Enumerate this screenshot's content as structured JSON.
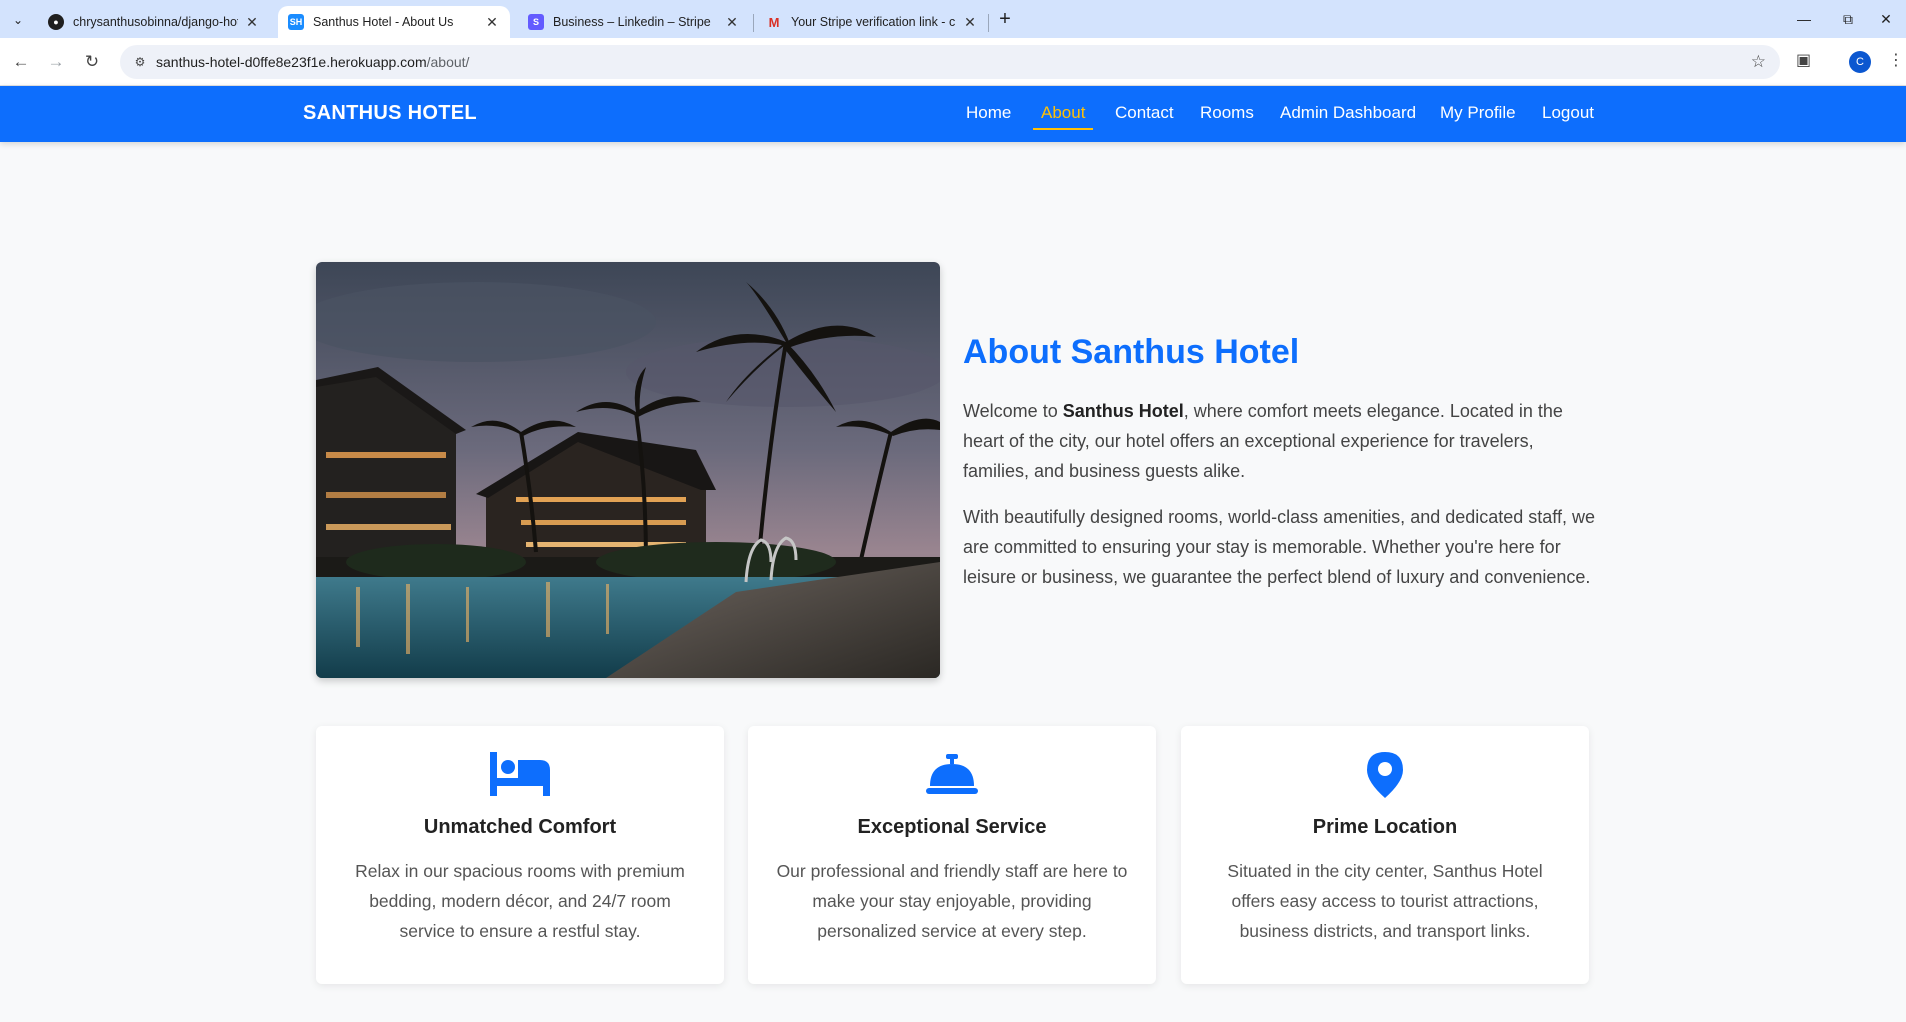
{
  "browser": {
    "tabs": [
      {
        "title": "chrysanthusobinna/django-hot",
        "favicon": "github-icon"
      },
      {
        "title": "Santhus Hotel - About Us",
        "favicon": "SH",
        "active": true
      },
      {
        "title": "Business – Linkedin – Stripe",
        "favicon": "S"
      },
      {
        "title": "Your Stripe verification link - ch",
        "favicon": "gmail-icon"
      }
    ],
    "url_host": "santhus-hotel-d0ffe8e23f1e.herokuapp.com",
    "url_path": "/about/",
    "profile_initial": "C"
  },
  "navbar": {
    "brand": "SANTHUS HOTEL",
    "links": [
      "Home",
      "About",
      "Contact",
      "Rooms",
      "Admin Dashboard",
      "My Profile",
      "Logout"
    ],
    "active": "About"
  },
  "about": {
    "title": "About Santhus Hotel",
    "p1_pre": "Welcome to ",
    "p1_bold": "Santhus Hotel",
    "p1_post": ", where comfort meets elegance. Located in the heart of the city, our hotel offers an exceptional experience for travelers, families, and business guests alike.",
    "p2": "With beautifully designed rooms, world-class amenities, and dedicated staff, we are committed to ensuring your stay is memorable. Whether you're here for leisure or business, we guarantee the perfect blend of luxury and convenience."
  },
  "features": [
    {
      "icon": "bed-icon",
      "title": "Unmatched Comfort",
      "text": "Relax in our spacious rooms with premium bedding, modern décor, and 24/7 room service to ensure a restful stay."
    },
    {
      "icon": "concierge-bell-icon",
      "title": "Exceptional Service",
      "text": "Our professional and friendly staff are here to make your stay enjoyable, providing personalized service at every step."
    },
    {
      "icon": "location-pin-icon",
      "title": "Prime Location",
      "text": "Situated in the city center, Santhus Hotel offers easy access to tourist attractions, business districts, and transport links."
    }
  ],
  "colors": {
    "primary": "#0d6efd",
    "active_link": "#ffc107",
    "page_bg": "#f8f9fa"
  }
}
